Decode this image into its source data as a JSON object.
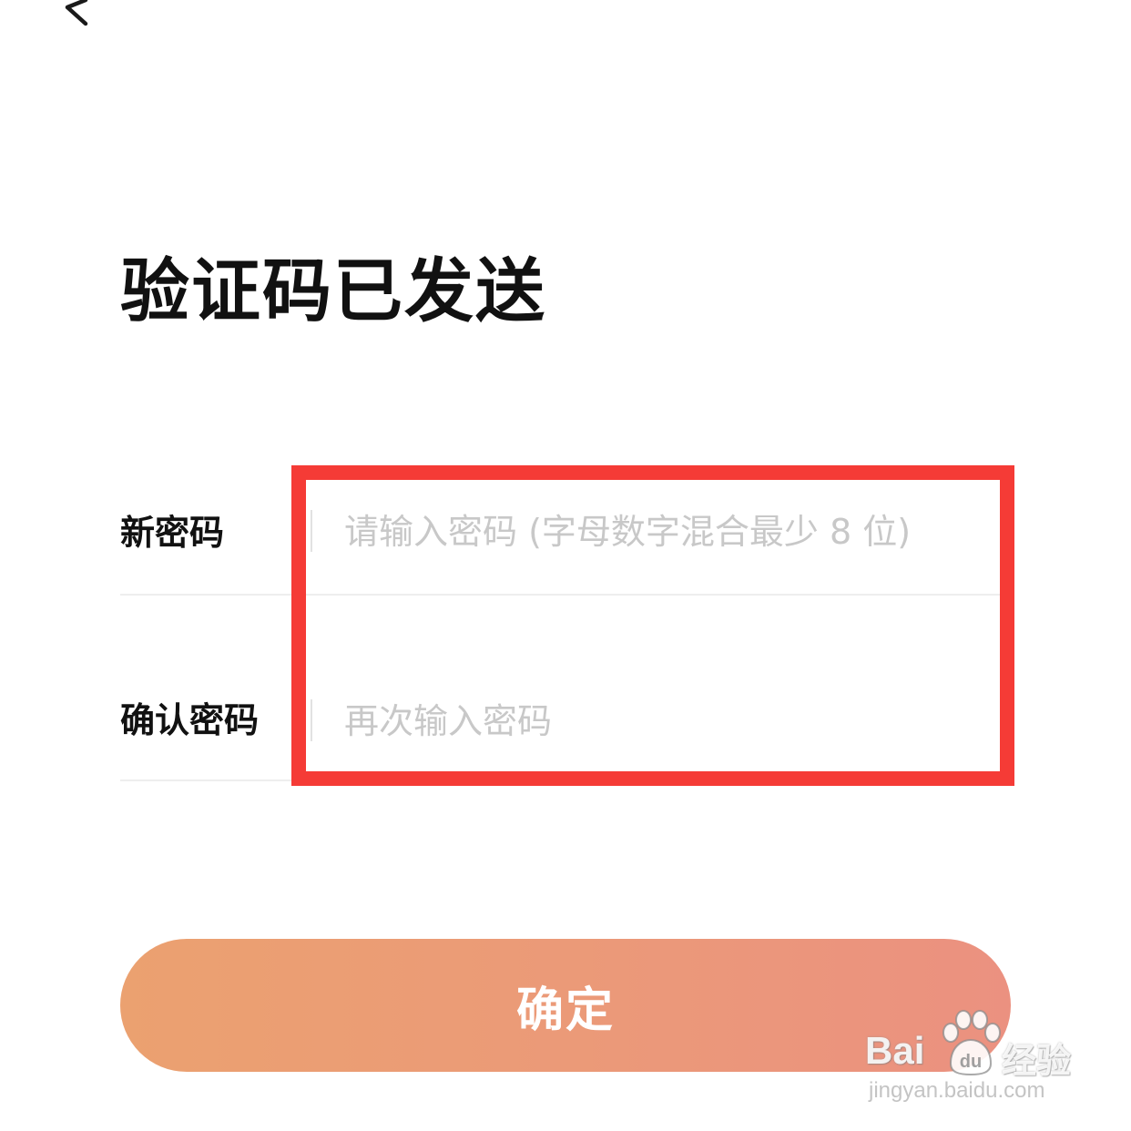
{
  "header": {
    "back_icon": "chevron-left-icon"
  },
  "page": {
    "title": "验证码已发送"
  },
  "form": {
    "new_password": {
      "label": "新密码",
      "placeholder": "请输入密码 (字母数字混合最少 8 位)",
      "value": ""
    },
    "confirm_password": {
      "label": "确认密码",
      "placeholder": "再次输入密码",
      "value": ""
    }
  },
  "annotation": {
    "highlight_color": "#f53b36"
  },
  "actions": {
    "confirm_label": "确定",
    "gradient_start": "#eba170",
    "gradient_end": "#eb9180"
  },
  "watermark": {
    "brand": "Bai",
    "brand_suffix": "du",
    "product": "经验",
    "url": "jingyan.baidu.com"
  }
}
